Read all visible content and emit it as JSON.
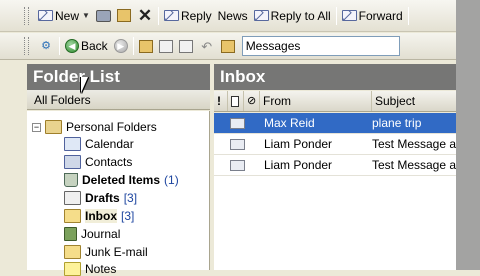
{
  "toolbar1": {
    "new_label": "New",
    "reply_label": "Reply",
    "news_label": "News",
    "reply_all_label": "Reply to All",
    "forward_label": "Forward"
  },
  "toolbar2": {
    "back_label": "Back",
    "address_value": "Messages"
  },
  "folder_pane": {
    "title": "Folder List",
    "dropdown_label": "All Folders",
    "root_label": "Personal Folders",
    "folders": [
      {
        "label": "Calendar",
        "count": ""
      },
      {
        "label": "Contacts",
        "count": ""
      },
      {
        "label": "Deleted Items",
        "count": "(1)"
      },
      {
        "label": "Drafts",
        "count": "[3]"
      },
      {
        "label": "Inbox",
        "count": "[3]"
      },
      {
        "label": "Journal",
        "count": ""
      },
      {
        "label": "Junk E-mail",
        "count": ""
      },
      {
        "label": "Notes",
        "count": ""
      }
    ]
  },
  "inbox": {
    "title": "Inbox",
    "columns": {
      "importance": "!",
      "type": "",
      "attachment": "",
      "from": "From",
      "subject": "Subject"
    },
    "messages": [
      {
        "from": "Max Reid",
        "subject": "plane trip",
        "selected": true
      },
      {
        "from": "Liam Ponder",
        "subject": "Test Message a",
        "selected": false
      },
      {
        "from": "Liam Ponder",
        "subject": "Test Message a",
        "selected": false
      }
    ]
  },
  "colors": {
    "pane_header": "#767675",
    "selection": "#316ac5",
    "toolbar_bg": "#ece9d8",
    "unread_count": "#1e46a0"
  }
}
